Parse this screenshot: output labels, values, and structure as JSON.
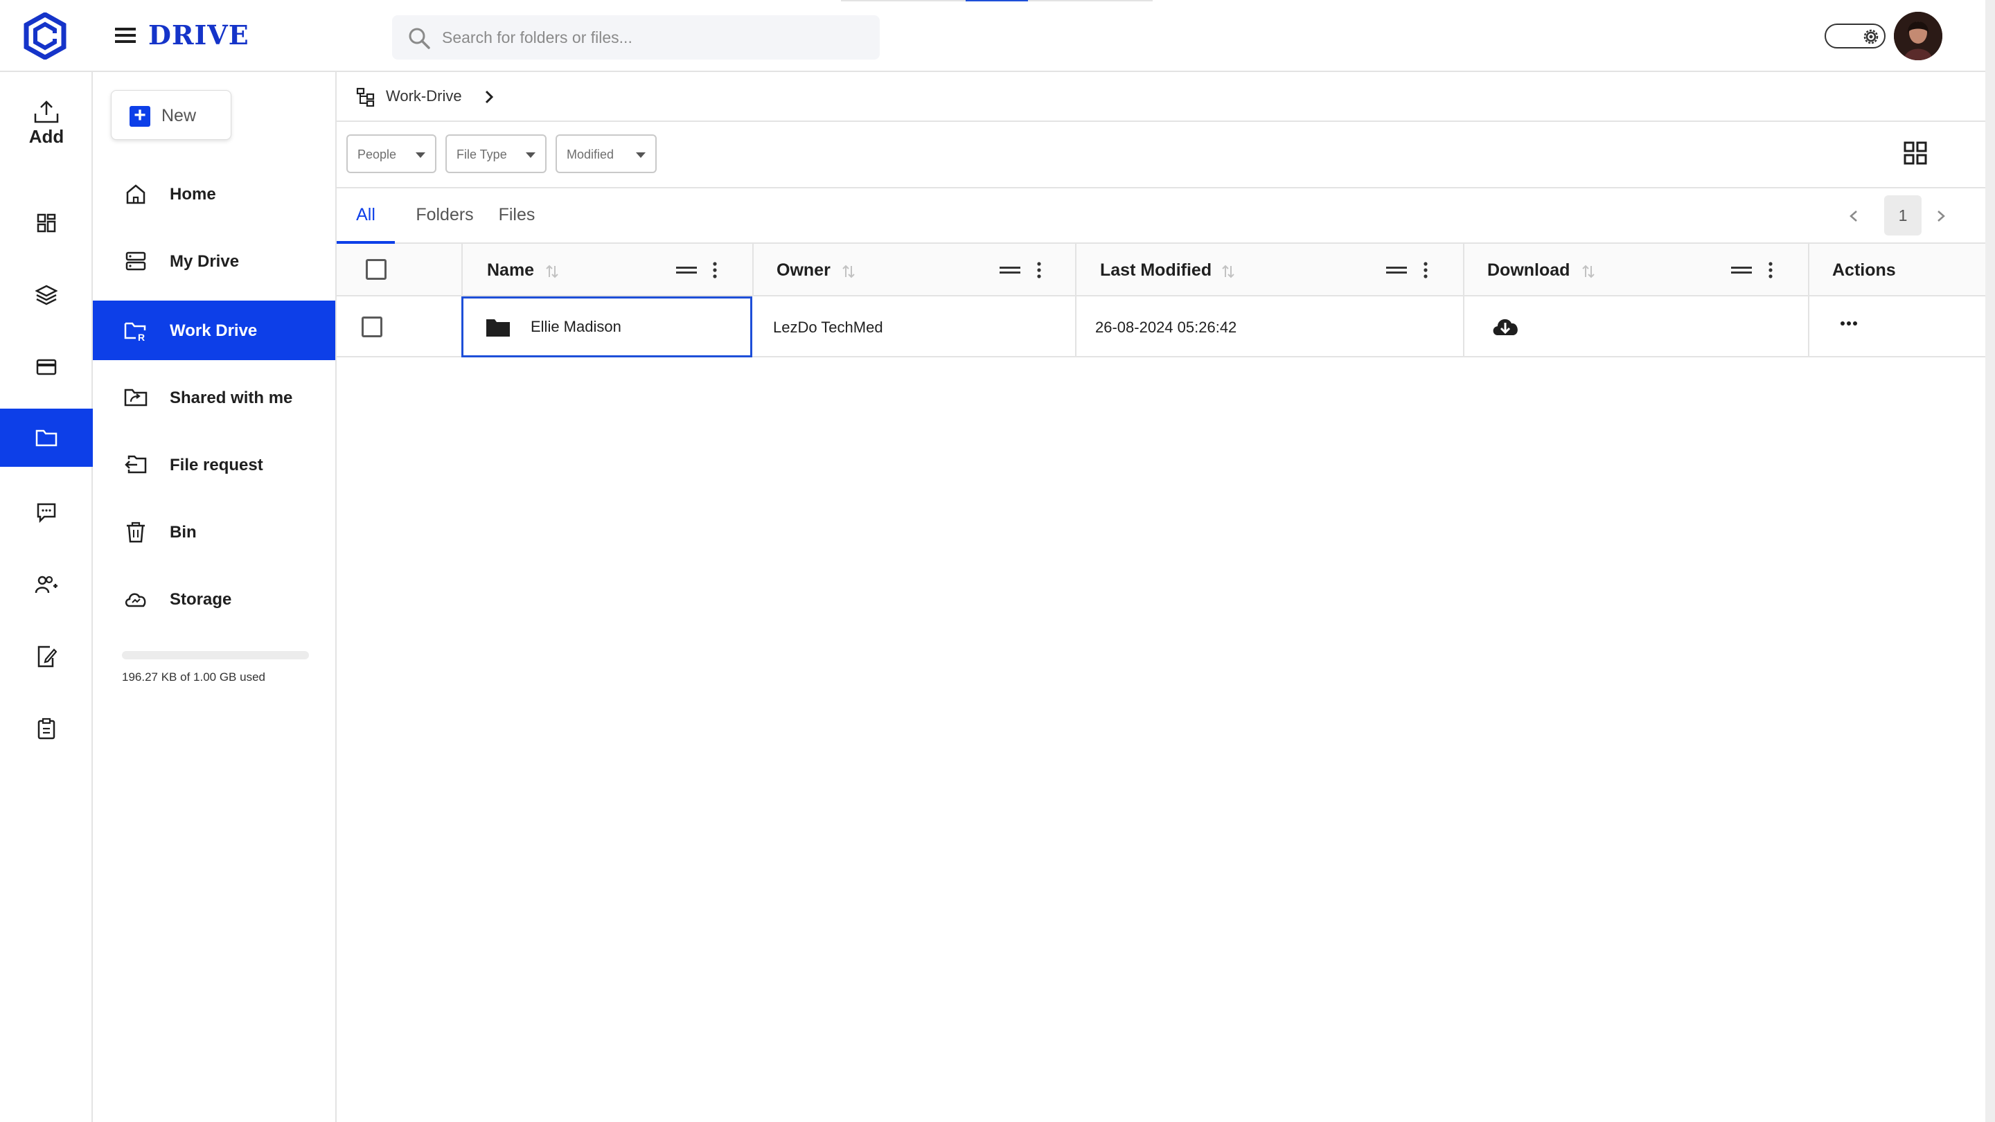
{
  "app": {
    "brand": "DRIVE",
    "colors": {
      "accent": "#0d3fe8",
      "brand_text": "#1534c9",
      "border": "#e3e3e3"
    }
  },
  "search": {
    "placeholder": "Search for folders or files...",
    "value": ""
  },
  "rail": {
    "add_label": "Add",
    "items": [
      {
        "icon": "dashboard-icon"
      },
      {
        "icon": "layers-icon"
      },
      {
        "icon": "card-icon"
      },
      {
        "icon": "folder-icon",
        "active": true
      },
      {
        "icon": "chat-icon"
      },
      {
        "icon": "users-icon"
      },
      {
        "icon": "edit-document-icon"
      },
      {
        "icon": "clipboard-icon"
      }
    ]
  },
  "sidebar": {
    "new_label": "New",
    "items": [
      {
        "label": "Home",
        "icon": "home-icon"
      },
      {
        "label": "My Drive",
        "icon": "drive-icon"
      },
      {
        "label": "Work Drive",
        "icon": "work-drive-icon",
        "active": true
      },
      {
        "label": "Shared with me",
        "icon": "shared-folder-icon"
      },
      {
        "label": "File request",
        "icon": "file-request-icon"
      },
      {
        "label": "Bin",
        "icon": "trash-icon"
      },
      {
        "label": "Storage",
        "icon": "cloud-icon"
      }
    ],
    "storage": {
      "used_text": "196.27 KB of 1.00 GB used",
      "used_fraction": 0.0002
    }
  },
  "breadcrumb": {
    "items": [
      "Work-Drive"
    ]
  },
  "filters": {
    "people": "People",
    "file_type": "File Type",
    "modified": "Modified"
  },
  "tabs": {
    "all": "All",
    "folders": "Folders",
    "files": "Files",
    "active": "All"
  },
  "pagination": {
    "current_page": "1"
  },
  "table": {
    "columns": {
      "name": "Name",
      "owner": "Owner",
      "last_modified": "Last Modified",
      "download": "Download",
      "actions": "Actions"
    },
    "rows": [
      {
        "name": "Ellie Madison",
        "type": "folder",
        "owner": "LezDo TechMed",
        "last_modified": "26-08-2024 05:26:42"
      }
    ]
  }
}
